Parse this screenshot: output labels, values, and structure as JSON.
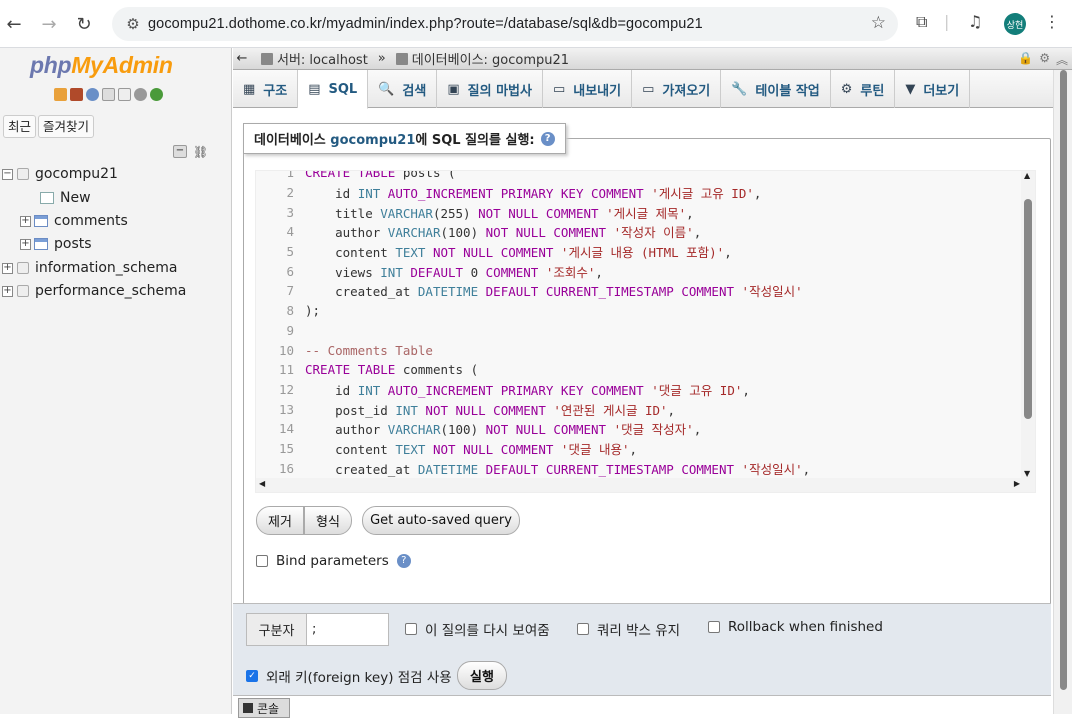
{
  "browser": {
    "url": "gocompu21.dothome.co.kr/myadmin/index.php?route=/database/sql&db=gocompu21",
    "avatar": "상현"
  },
  "sidebar": {
    "logo_php": "php",
    "logo_ma": "MyAdmin",
    "recent": "최근",
    "favorites": "즐겨찾기",
    "tree": [
      {
        "label": "gocompu21"
      },
      {
        "label": "New"
      },
      {
        "label": "comments"
      },
      {
        "label": "posts"
      },
      {
        "label": "information_schema"
      },
      {
        "label": "performance_schema"
      }
    ]
  },
  "breadcrumb": {
    "server": "서버: localhost",
    "sep": "»",
    "db": "데이터베이스: gocompu21"
  },
  "tabs": [
    {
      "label": "구조"
    },
    {
      "label": "SQL"
    },
    {
      "label": "검색"
    },
    {
      "label": "질의 마법사"
    },
    {
      "label": "내보내기"
    },
    {
      "label": "가져오기"
    },
    {
      "label": "테이블 작업"
    },
    {
      "label": "루틴"
    },
    {
      "label": "더보기"
    }
  ],
  "legend": {
    "prefix": "데이터베이스 ",
    "db": "gocompu21",
    "suffix": "에 SQL 질의를 실행:"
  },
  "code_lines": [
    [
      "1",
      "CREATE TABLE posts ("
    ],
    [
      "2",
      "    id INT AUTO_INCREMENT PRIMARY KEY COMMENT '게시글 고유 ID',"
    ],
    [
      "3",
      "    title VARCHAR(255) NOT NULL COMMENT '게시글 제목',"
    ],
    [
      "4",
      "    author VARCHAR(100) NOT NULL COMMENT '작성자 이름',"
    ],
    [
      "5",
      "    content TEXT NOT NULL COMMENT '게시글 내용 (HTML 포함)',"
    ],
    [
      "6",
      "    views INT DEFAULT 0 COMMENT '조회수',"
    ],
    [
      "7",
      "    created_at DATETIME DEFAULT CURRENT_TIMESTAMP COMMENT '작성일시'"
    ],
    [
      "8",
      ");"
    ],
    [
      "9",
      ""
    ],
    [
      "10",
      "-- Comments Table"
    ],
    [
      "11",
      "CREATE TABLE comments ("
    ],
    [
      "12",
      "    id INT AUTO_INCREMENT PRIMARY KEY COMMENT '댓글 고유 ID',"
    ],
    [
      "13",
      "    post_id INT NOT NULL COMMENT '연관된 게시글 ID',"
    ],
    [
      "14",
      "    author VARCHAR(100) NOT NULL COMMENT '댓글 작성자',"
    ],
    [
      "15",
      "    content TEXT NOT NULL COMMENT '댓글 내용',"
    ],
    [
      "16",
      "    created_at DATETIME DEFAULT CURRENT_TIMESTAMP COMMENT '작성일시',"
    ]
  ],
  "buttons": {
    "clear": "제거",
    "format": "형식",
    "autosaved": "Get auto-saved query",
    "go": "실행"
  },
  "bind_params": "Bind parameters",
  "options": {
    "delimiter_label": "구분자",
    "delimiter_value": ";",
    "show_again": "이 질의를 다시 보여줌",
    "retain_box": "쿼리 박스 유지",
    "rollback": "Rollback when finished",
    "fk_check": "외래 키(foreign key) 점검 사용"
  },
  "console_label": "콘솔"
}
